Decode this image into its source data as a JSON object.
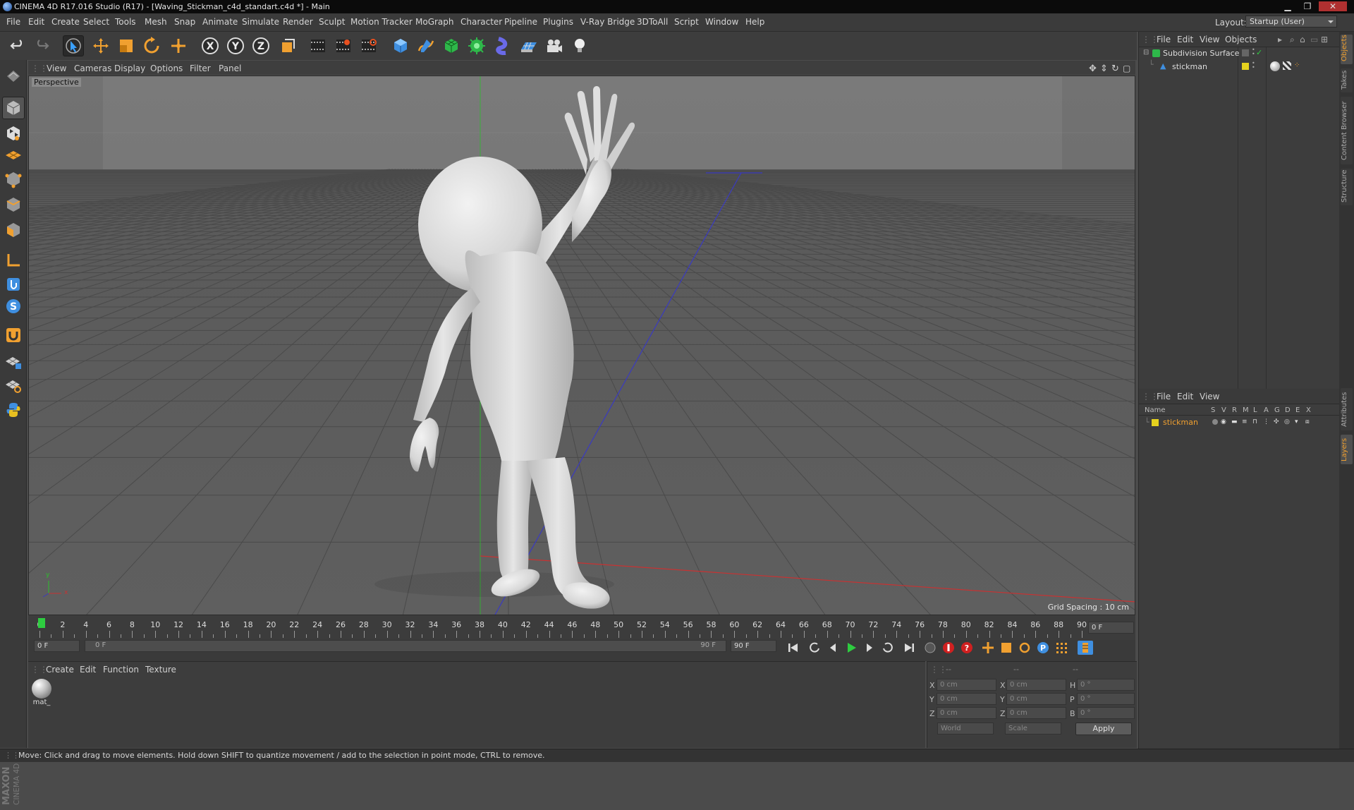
{
  "titlebar": {
    "title": "CINEMA 4D R17.016 Studio (R17) - [Waving_Stickman_c4d_standart.c4d *] - Main"
  },
  "menubar": {
    "items": [
      "File",
      "Edit",
      "Create",
      "Select",
      "Tools",
      "Mesh",
      "Snap",
      "Animate",
      "Simulate",
      "Render",
      "Sculpt",
      "Motion Tracker",
      "MoGraph",
      "Character",
      "Pipeline",
      "Plugins",
      "V-Ray Bridge",
      "3DToAll",
      "Script",
      "Window",
      "Help"
    ],
    "layout_label": "Layout:",
    "layout_value": "Startup (User)"
  },
  "toolbar": {
    "icons": [
      "undo-icon",
      "redo-icon",
      "live-selection-icon",
      "move-icon",
      "scale-icon",
      "rotate-icon",
      "recent-tool-icon",
      "x-axis-lock-icon",
      "y-axis-lock-icon",
      "z-axis-lock-icon",
      "coordinate-system-icon",
      "render-view-icon",
      "render-picture-viewer-icon",
      "render-settings-icon",
      "cube-icon",
      "pen-spline-icon",
      "subdivision-icon",
      "cloner-icon",
      "deformer-icon",
      "floor-icon",
      "camera-icon",
      "light-icon"
    ]
  },
  "viewport": {
    "menu": [
      "View",
      "Cameras",
      "Display",
      "Options",
      "Filter",
      "Panel"
    ],
    "camera_label": "Perspective",
    "grid_spacing": "Grid Spacing : 10 cm",
    "axis_y": "y",
    "axis_x": "x"
  },
  "timeline": {
    "ticks": [
      "0",
      "2",
      "4",
      "6",
      "8",
      "10",
      "12",
      "14",
      "16",
      "18",
      "20",
      "22",
      "24",
      "26",
      "28",
      "30",
      "32",
      "34",
      "36",
      "38",
      "40",
      "42",
      "44",
      "46",
      "48",
      "50",
      "52",
      "54",
      "56",
      "58",
      "60",
      "62",
      "64",
      "66",
      "68",
      "70",
      "72",
      "74",
      "76",
      "78",
      "80",
      "82",
      "84",
      "86",
      "88",
      "90"
    ],
    "current_frame": "0 F",
    "playhead_value": 0,
    "range_max": 90
  },
  "playback": {
    "start_field": "0 F",
    "range_start": "0 F",
    "range_end": "90 F",
    "end_field": "90 F"
  },
  "material_manager": {
    "menu": [
      "Create",
      "Edit",
      "Function",
      "Texture"
    ],
    "materials": [
      {
        "name": "mat_"
      }
    ]
  },
  "coordinates": {
    "header": [
      "--",
      "--",
      "--"
    ],
    "rows": [
      {
        "pos_label": "X",
        "pos": "0 cm",
        "size_label": "X",
        "size": "0 cm",
        "rot_label": "H",
        "rot": "0 °"
      },
      {
        "pos_label": "Y",
        "pos": "0 cm",
        "size_label": "Y",
        "size": "0 cm",
        "rot_label": "P",
        "rot": "0 °"
      },
      {
        "pos_label": "Z",
        "pos": "0 cm",
        "size_label": "Z",
        "size": "0 cm",
        "rot_label": "B",
        "rot": "0 °"
      }
    ],
    "mode_1": "World",
    "mode_2": "Scale",
    "apply": "Apply"
  },
  "object_manager": {
    "menu": [
      "File",
      "Edit",
      "View",
      "Objects"
    ],
    "objects": [
      {
        "name": "Subdivision Surface"
      },
      {
        "name": "stickman"
      }
    ]
  },
  "layer_manager": {
    "menu": [
      "File",
      "Edit",
      "View"
    ],
    "columns": [
      "Name",
      "S",
      "V",
      "R",
      "M",
      "L",
      "A",
      "G",
      "D",
      "E",
      "X"
    ],
    "layers": [
      {
        "name": "stickman"
      }
    ]
  },
  "right_tabs": [
    "Objects",
    "Takes",
    "Content Browser",
    "Structure",
    "Attributes",
    "Layers"
  ],
  "statusbar": {
    "text": "Move: Click and drag to move elements. Hold down SHIFT to quantize movement / add to the selection in point mode, CTRL to remove."
  },
  "brand": {
    "maxon": "MAXON",
    "cinema": "CINEMA 4D"
  },
  "colors": {
    "accent_orange": "#f0a030",
    "layer_yellow": "#e6d21e",
    "axis_red": "#c83232",
    "axis_green": "#32c832",
    "axis_blue": "#3232c8"
  }
}
